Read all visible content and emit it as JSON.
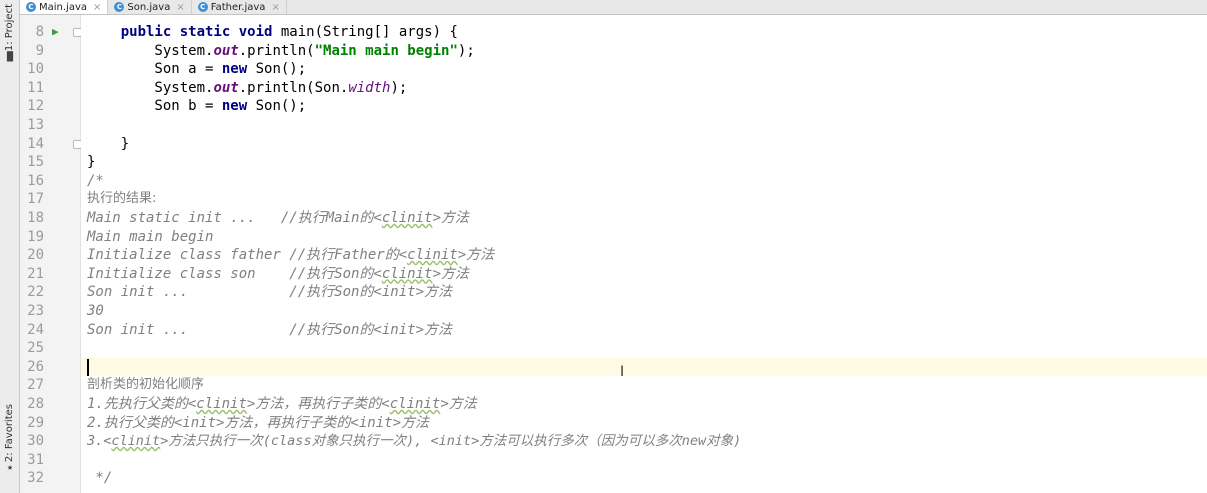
{
  "side_tools": {
    "project_label": "1: Project",
    "favorites_label": "2: Favorites"
  },
  "tabs": [
    {
      "label": "Main.java",
      "icon": "C",
      "close": "×"
    },
    {
      "label": "Son.java",
      "icon": "C",
      "close": "×"
    },
    {
      "label": "Father.java",
      "icon": "C",
      "close": "×"
    }
  ],
  "editor": {
    "line_numbers": [
      "8",
      "9",
      "10",
      "11",
      "12",
      "13",
      "14",
      "15",
      "16",
      "17",
      "18",
      "19",
      "20",
      "21",
      "22",
      "23",
      "24",
      "25",
      "26",
      "27",
      "28",
      "29",
      "30",
      "31",
      "32"
    ],
    "code": {
      "l8": [
        "    ",
        "public static void",
        " main(String[] args) {"
      ],
      "l9": [
        "        System.",
        "out",
        ".println(",
        "\"Main main begin\"",
        ");"
      ],
      "l10": [
        "        Son a = ",
        "new",
        " Son();"
      ],
      "l11": [
        "        System.",
        "out",
        ".println(Son.",
        "width",
        ");"
      ],
      "l12": [
        "        Son b = ",
        "new",
        " Son();"
      ],
      "l14": "    }",
      "l15": "}",
      "l16": "/*",
      "l17": "执行的结果:",
      "l18": [
        "Main static init ...   //执行Main的<",
        "clinit",
        ">方法"
      ],
      "l19": "Main main begin",
      "l20": [
        "Initialize class father //执行Father的<",
        "clinit",
        ">方法"
      ],
      "l21": [
        "Initialize class son    //执行Son的<",
        "clinit",
        ">方法"
      ],
      "l22": "Son init ...            //执行Son的<init>方法",
      "l23": "30",
      "l24": "Son init ...            //执行Son的<init>方法",
      "l27": "剖析类的初始化顺序",
      "l28": [
        "1.先执行父类的<",
        "clinit",
        ">方法，再执行子类的<",
        "clinit",
        ">方法"
      ],
      "l29": "2.执行父类的<init>方法，再执行子类的<init>方法",
      "l30": [
        "3.<",
        "clinit",
        ">方法只执行一次(class对象只执行一次), <init>方法可以执行多次（因为可以多次new对象)"
      ],
      "l32": " */"
    }
  }
}
